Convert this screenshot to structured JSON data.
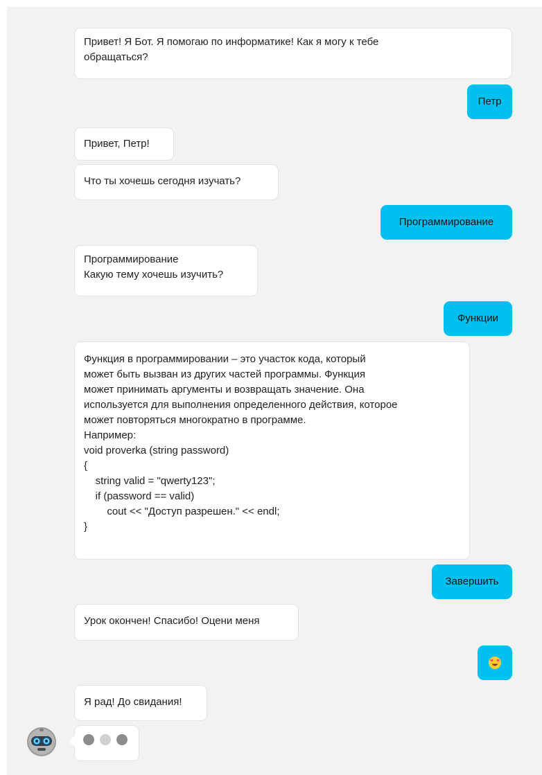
{
  "messages": [
    {
      "role": "bot",
      "text": "Привет! Я Бот. Я помогаю по информатике! Как я могу к тебе\nобращаться?"
    },
    {
      "role": "user",
      "text": "Петр"
    },
    {
      "role": "bot",
      "text": "Привет, Петр!"
    },
    {
      "role": "bot",
      "text": "Что ты хочешь сегодня изучать?"
    },
    {
      "role": "user",
      "text": "Программирование"
    },
    {
      "role": "bot",
      "text": "Программирование\nКакую тему хочешь изучить?"
    },
    {
      "role": "user",
      "text": "Функции"
    },
    {
      "role": "bot",
      "text": "Функция в программировании – это участок кода, который\nможет быть вызван из других частей программы. Функция\nможет принимать аргументы и возвращать значение. Она\nиспользуется для выполнения определенного действия, которое\nможет повторяться многократно в программе.\nНапример:\nvoid proverka (string password)\n{\n    string valid = \"qwerty123\";\n    if (password == valid)\n        cout << \"Доступ разрешен.\" << endl;\n}"
    },
    {
      "role": "user",
      "text": "Завершить"
    },
    {
      "role": "bot",
      "text": "Урок окончен! Спасибо! Оцени меня"
    },
    {
      "role": "user",
      "icon": "heart-eyes-emoji-icon"
    },
    {
      "role": "bot",
      "text": "Я рад! До свидания!"
    }
  ],
  "typing_indicator": {
    "dots": [
      "#8c8c8c",
      "#d0d0d0",
      "#8c8c8c"
    ]
  },
  "avatar": {
    "icon": "robot-avatar-icon"
  },
  "colors": {
    "background": "#f2f2f2",
    "bot_bubble": "#ffffff",
    "user_bubble": "#00c0f0"
  }
}
